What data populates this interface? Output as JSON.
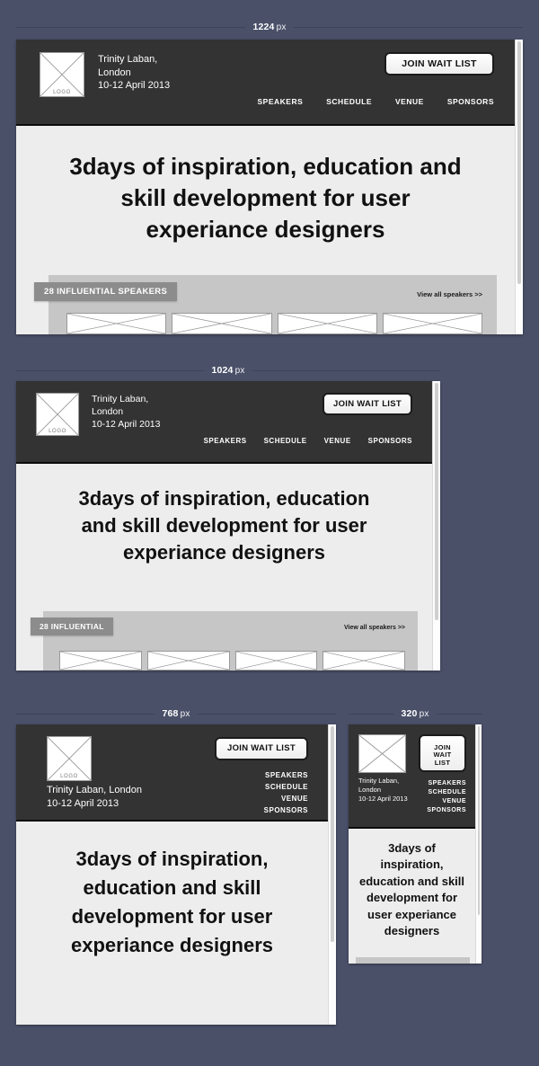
{
  "theme": {
    "page_background": "#4a5068",
    "header_background": "#333333",
    "panel_background": "#ededed",
    "badge_background": "#8c8c8c",
    "speakers_strip_background": "#c6c6c6",
    "text_light": "#ffffff",
    "text_dark": "#111111"
  },
  "site": {
    "logo_label": "LOGO",
    "logo_icon": "placeholder-cross-icon",
    "venue_line1": "Trinity Laban,",
    "venue_line2": "London",
    "dates": "10-12 April 2013",
    "address_stacked": "Trinity Laban,\nLondon\n10-12 April 2013",
    "address_inline": "Trinity Laban, London\n10-12 April 2013",
    "cta_label": "JOIN WAIT LIST",
    "cta_label_stacked": "JOIN\nWAIT\nLIST",
    "nav_items": [
      {
        "label": "SPEAKERS"
      },
      {
        "label": "SCHEDULE"
      },
      {
        "label": "VENUE"
      },
      {
        "label": "SPONSORS"
      }
    ],
    "hero_title": "3days of inspiration, education and skill development for user experiance designers",
    "speakers_badge_full": "28 INFLUENTIAL SPEAKERS",
    "speakers_badge_short": "28 INFLUENTIAL",
    "view_all_link": "View all speakers  >>",
    "speaker_card_count": 4
  },
  "breakpoints": [
    {
      "id": "bp1224",
      "width_number": "1224",
      "unit": "px"
    },
    {
      "id": "bp1024",
      "width_number": "1024",
      "unit": "px"
    },
    {
      "id": "bp768",
      "width_number": "768",
      "unit": "px"
    },
    {
      "id": "bp320",
      "width_number": "320",
      "unit": "px"
    }
  ]
}
